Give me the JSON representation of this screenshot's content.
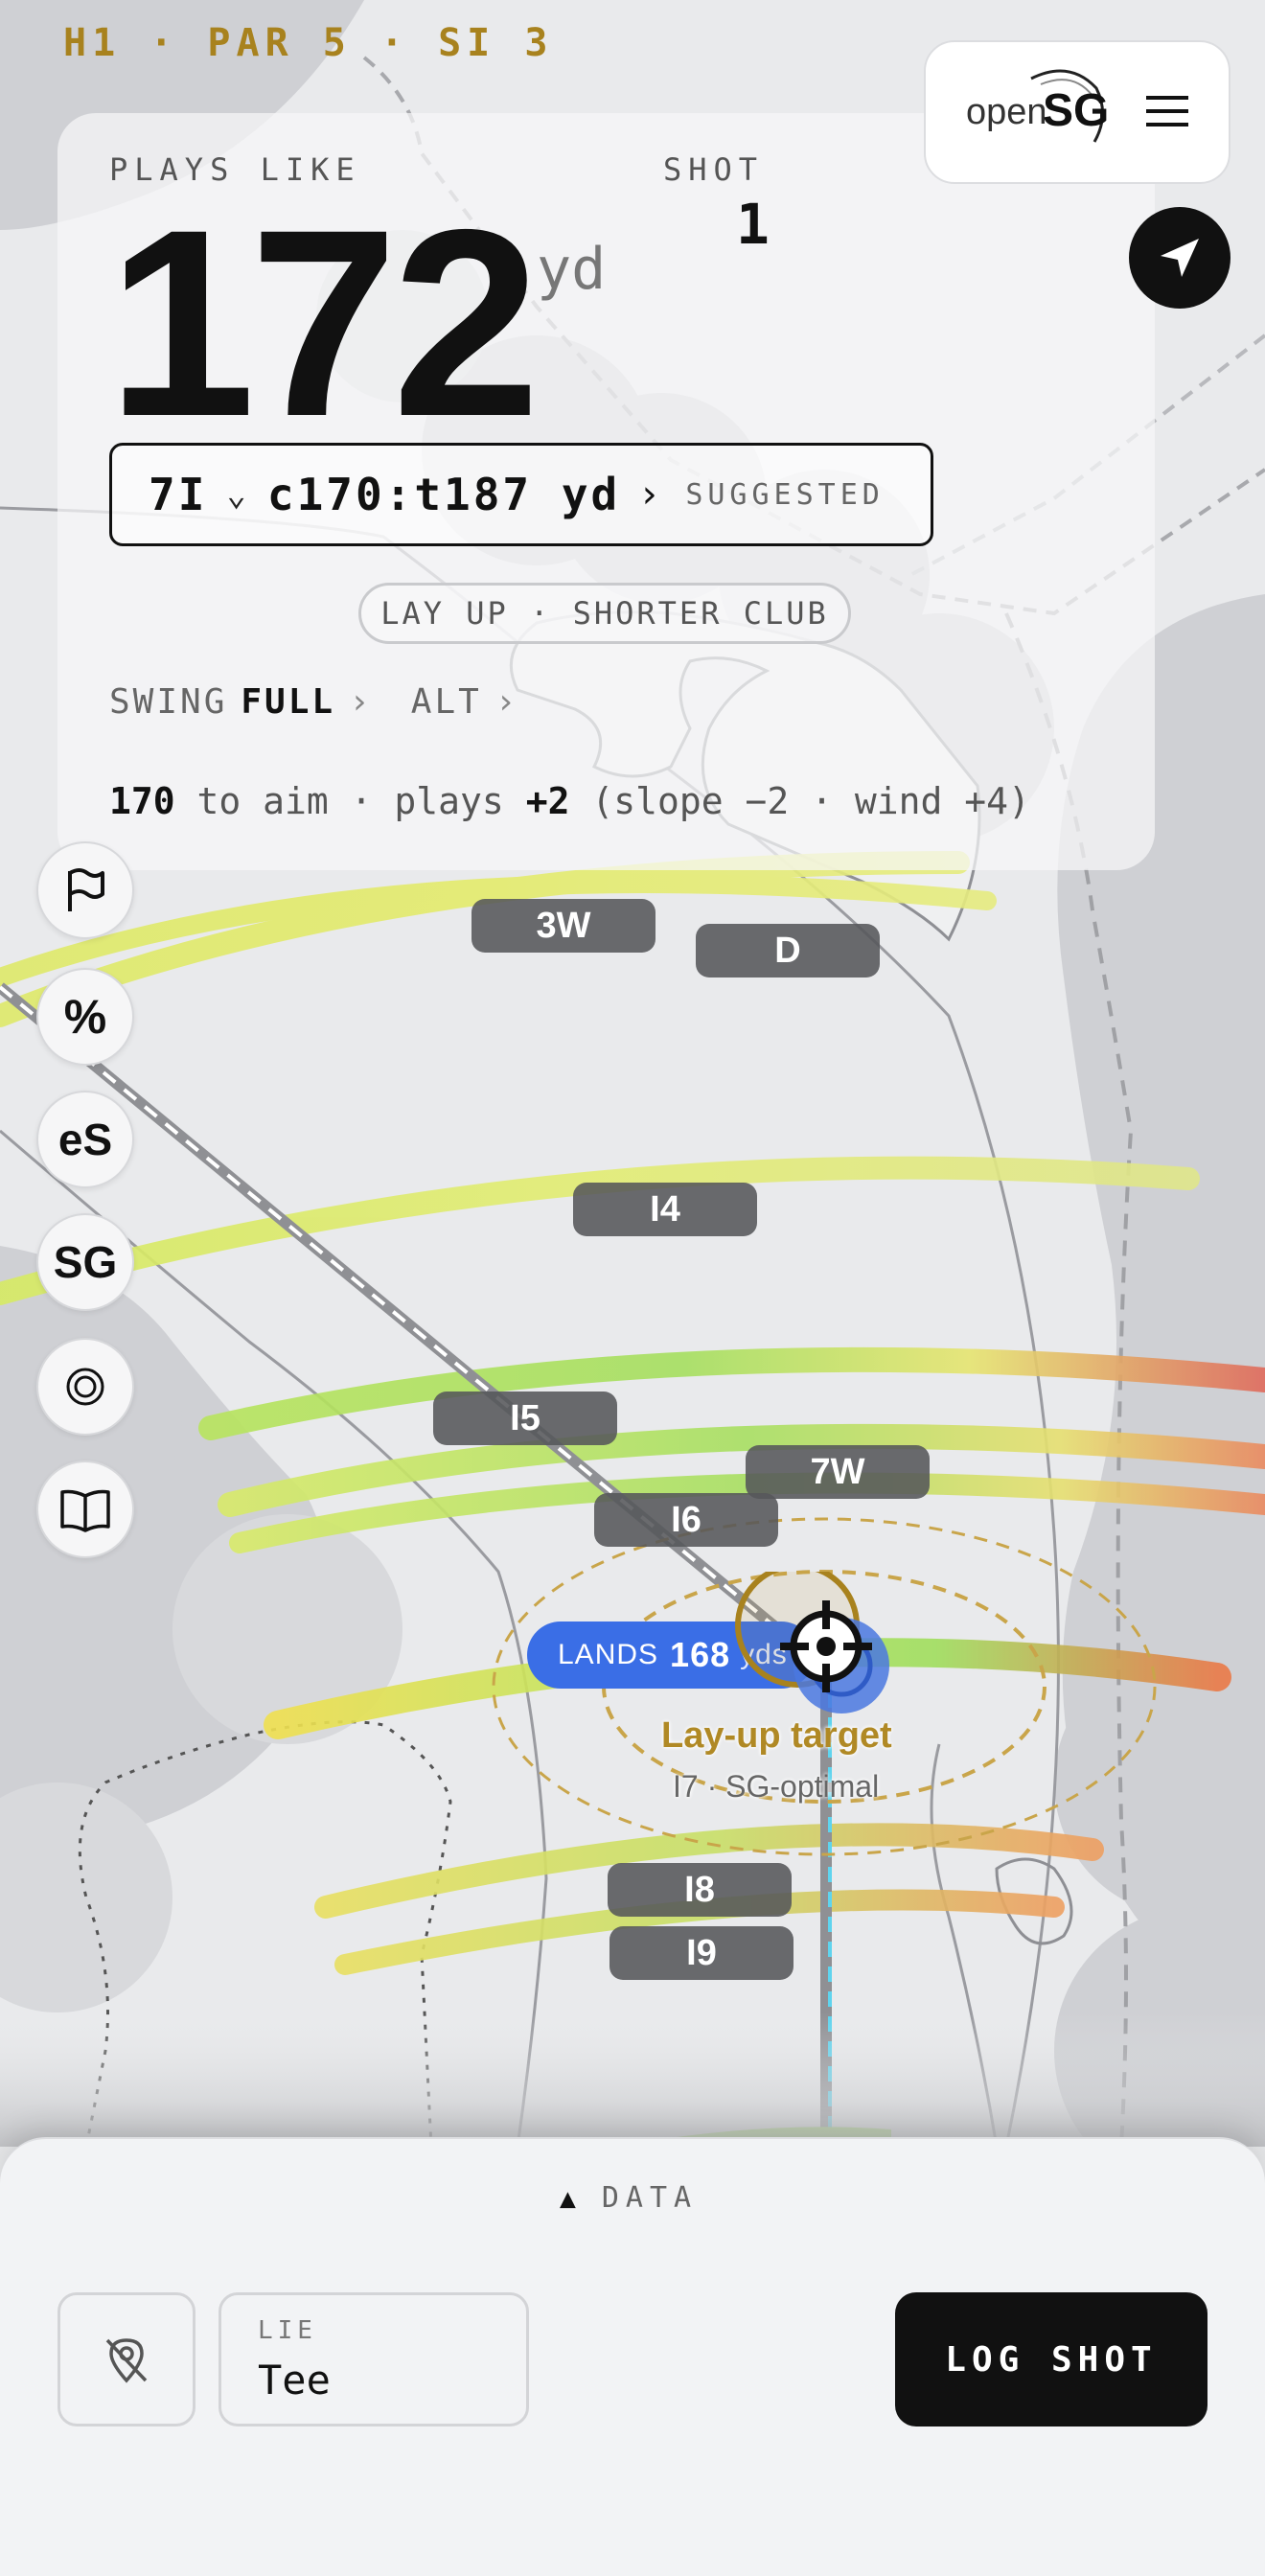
{
  "hole": {
    "info": "H1 · PAR 5 · SI 3"
  },
  "plays_like": {
    "label": "PLAYS LIKE",
    "value": "172",
    "unit": "yd"
  },
  "shot": {
    "label": "SHOT",
    "number": "1"
  },
  "club_selector": {
    "club": "7I",
    "carry": "c170:t187 yd",
    "status": "SUGGESTED"
  },
  "strategy": {
    "label": "LAY UP · SHORTER CLUB"
  },
  "swing": {
    "label": "SWING",
    "value": "FULL",
    "alt_label": "ALT"
  },
  "aim": {
    "aim_value": "170",
    "aim_text": " to aim · plays ",
    "plays_value": "+2",
    "adjust_text": " (slope −2 · wind +4)"
  },
  "logo": {
    "open": "open",
    "sg": "SG"
  },
  "tools": {
    "percent": "%",
    "es": "eS",
    "sg": "SG"
  },
  "map": {
    "club_labels": [
      "3W",
      "D",
      "I4",
      "I5",
      "7W",
      "I6",
      "I8",
      "I9"
    ],
    "lands": {
      "label": "LANDS",
      "value": "168",
      "unit": "yds"
    },
    "target": {
      "title": "Lay-up target",
      "subtitle": "I7 · SG-optimal"
    }
  },
  "sheet": {
    "data_toggle": "DATA",
    "lie_label": "LIE",
    "lie_value": "Tee",
    "log_button": "LOG SHOT"
  },
  "icons": {
    "flag": "flag-icon",
    "target": "target-icon",
    "book": "book-icon",
    "navigate": "navigation-arrow-icon",
    "menu": "menu-icon",
    "location_off": "location-off-icon"
  },
  "colors": {
    "accent_gold": "#a8821e",
    "lands_blue": "#3a6ee6",
    "button_dark": "#111111"
  }
}
